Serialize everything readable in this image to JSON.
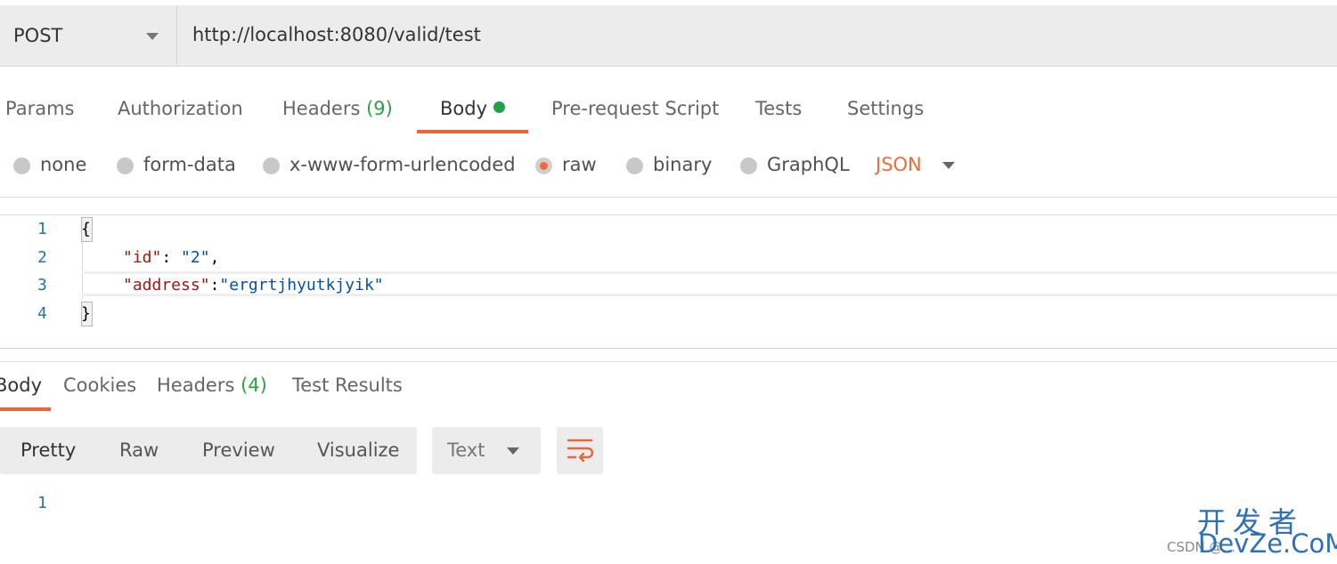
{
  "request": {
    "method": "POST",
    "url": "http://localhost:8080/valid/test"
  },
  "request_tabs": [
    {
      "label": "Params"
    },
    {
      "label": "Authorization"
    },
    {
      "label": "Headers",
      "count": "(9)"
    },
    {
      "label": "Body",
      "active": true,
      "indicator": "green-dot"
    },
    {
      "label": "Pre-request Script"
    },
    {
      "label": "Tests"
    },
    {
      "label": "Settings"
    }
  ],
  "body_types": [
    {
      "label": "none",
      "selected": false
    },
    {
      "label": "form-data",
      "selected": false
    },
    {
      "label": "x-www-form-urlencoded",
      "selected": false
    },
    {
      "label": "raw",
      "selected": true
    },
    {
      "label": "binary",
      "selected": false
    },
    {
      "label": "GraphQL",
      "selected": false
    }
  ],
  "raw_format": "JSON",
  "editor": {
    "line_numbers": [
      "1",
      "2",
      "3",
      "4"
    ],
    "open_brace": "{",
    "close_brace": "}",
    "line2": {
      "key": "\"id\"",
      "sep": ": ",
      "value": "\"2\"",
      "trail": ","
    },
    "line3": {
      "key": "\"address\"",
      "sep": ":",
      "value": "\"ergrtjhyutkjyik\""
    }
  },
  "response_tabs": [
    {
      "label": "Body",
      "active": true
    },
    {
      "label": "Cookies"
    },
    {
      "label": "Headers",
      "count": "(4)"
    },
    {
      "label": "Test Results"
    }
  ],
  "view_modes": [
    {
      "label": "Pretty",
      "active": true
    },
    {
      "label": "Raw"
    },
    {
      "label": "Preview"
    },
    {
      "label": "Visualize"
    }
  ],
  "response_format": "Text",
  "response_lines": [
    "1"
  ],
  "watermark": {
    "cn": "开发者",
    "en": "DevZe.CoM",
    "csdn": "CSDN @..."
  },
  "colors": {
    "accent": "#e8663a",
    "indicator": "#26a046",
    "json_key": "#a31515",
    "json_string": "#0451a5",
    "line_number": "#237893"
  },
  "icons": [
    "chevron-down-icon",
    "green-dot-icon",
    "radio-icon",
    "wrap-lines-icon"
  ]
}
